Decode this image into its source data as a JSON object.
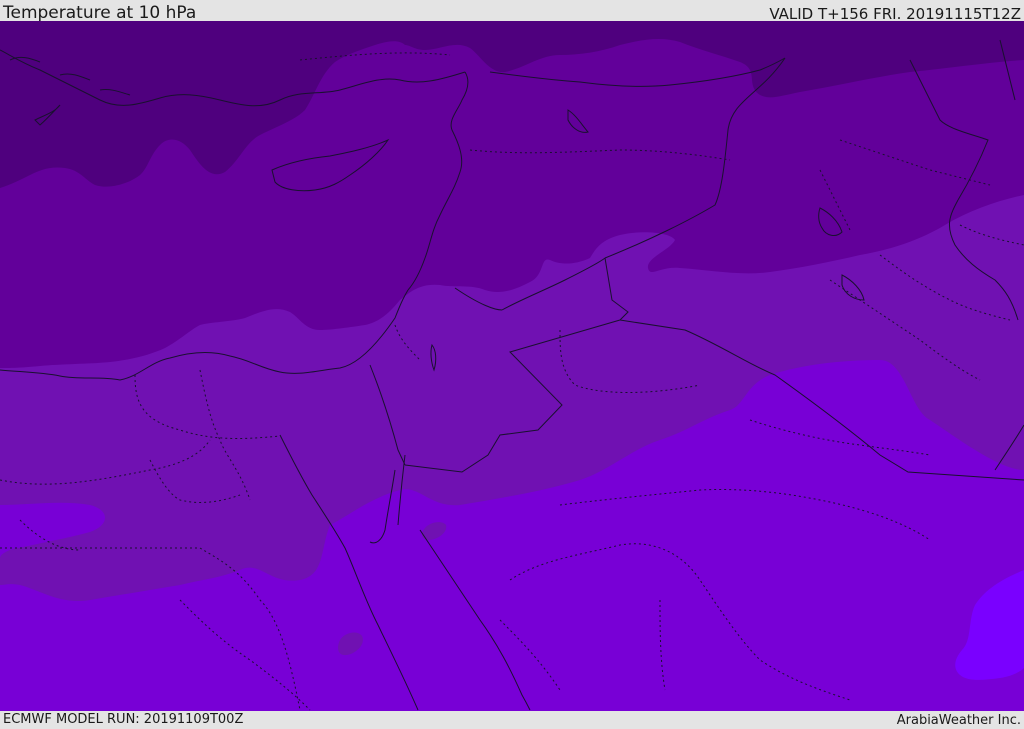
{
  "header": {
    "title": "Temperature at 10 hPa",
    "valid_time": "VALID T+156 FRI. 20191115T12Z"
  },
  "footer": {
    "model_run": "ECMWF MODEL RUN: 20191109T00Z",
    "credit": "ArabiaWeather Inc."
  },
  "map": {
    "field": "temperature",
    "level": "10 hPa",
    "color_bands": [
      "#4f007e",
      "#62009a",
      "#7011b2",
      "#7800d6",
      "#7a00ff"
    ],
    "boundaries": "coastlines, national borders (solid), regional borders (dotted)"
  }
}
